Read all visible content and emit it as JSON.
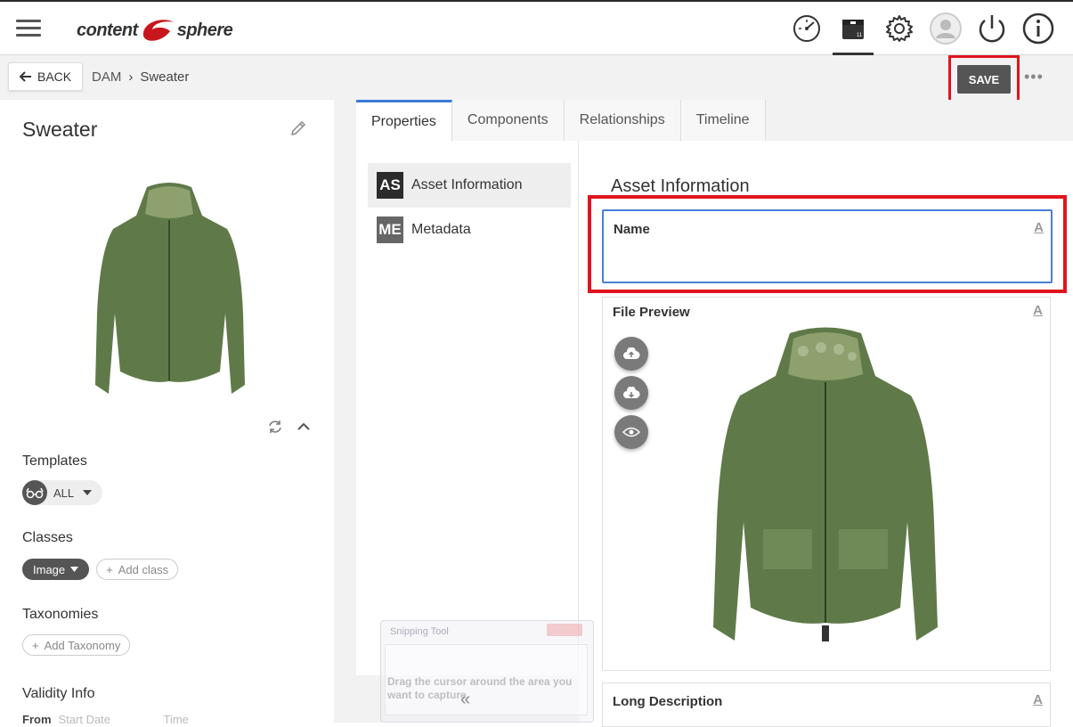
{
  "app": {
    "logo_text_left": "content",
    "logo_text_right": "sphere"
  },
  "toolbar": {
    "back_label": "BACK",
    "breadcrumb": [
      "DAM",
      "Sweater"
    ],
    "save_label": "SAVE",
    "more_label": "•••"
  },
  "left": {
    "asset_title": "Sweater",
    "templates_label": "Templates",
    "templates_value": "ALL",
    "classes_label": "Classes",
    "class_chip": "Image",
    "add_class": "Add class",
    "taxonomies_label": "Taxonomies",
    "add_taxonomy": "Add Taxonomy",
    "validity_label": "Validity Info",
    "from_label": "From",
    "start_date_placeholder": "Start Date",
    "time_placeholder": "Time"
  },
  "tabs": [
    "Properties",
    "Components",
    "Relationships",
    "Timeline"
  ],
  "subnav": [
    {
      "abbr": "AS",
      "label": "Asset Information"
    },
    {
      "abbr": "ME",
      "label": "Metadata"
    }
  ],
  "detail": {
    "title": "Asset Information",
    "name_label": "Name",
    "name_value": "",
    "file_preview_label": "File Preview",
    "long_description_label": "Long Description"
  },
  "overlay": {
    "snipping_title": "Snipping Tool",
    "snipping_text": "Drag the cursor around the area you want to capture."
  },
  "colors": {
    "accent_blue": "#4a7fd6",
    "highlight_red": "#e0141e",
    "logo_red": "#c8161d",
    "dark_btn": "#555555"
  }
}
